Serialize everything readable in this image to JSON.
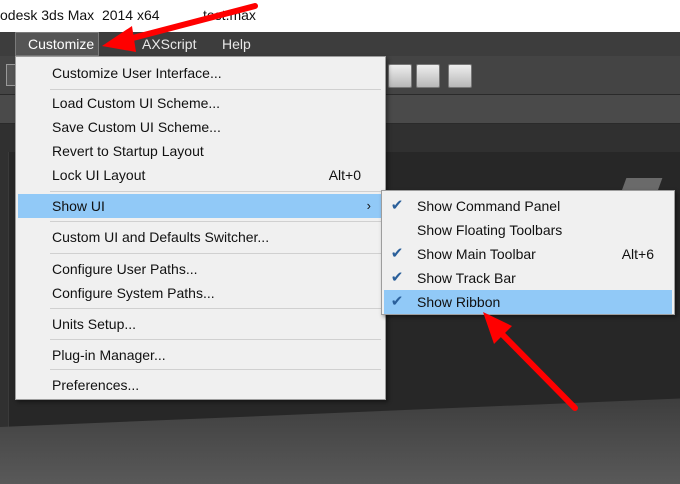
{
  "titlebar": {
    "app_title": "odesk 3ds Max  2014 x64",
    "file_name": "test.max"
  },
  "menubar": {
    "customize": "Customize",
    "maxscript": "AXScript",
    "help": "Help"
  },
  "customize_menu": {
    "items": [
      {
        "label": "Customize User Interface..."
      },
      {
        "label": "Load Custom UI Scheme..."
      },
      {
        "label": "Save Custom UI Scheme..."
      },
      {
        "label": "Revert to Startup Layout"
      },
      {
        "label": "Lock UI Layout",
        "shortcut": "Alt+0"
      },
      {
        "label": "Show UI",
        "submenu_arrow": "›"
      },
      {
        "label": "Custom UI and Defaults Switcher..."
      },
      {
        "label": "Configure User Paths..."
      },
      {
        "label": "Configure System Paths..."
      },
      {
        "label": "Units Setup..."
      },
      {
        "label": "Plug-in Manager..."
      },
      {
        "label": "Preferences..."
      }
    ]
  },
  "show_ui_submenu": {
    "check_glyph": "✔",
    "items": [
      {
        "label": "Show Command Panel",
        "checked": true
      },
      {
        "label": "Show Floating Toolbars",
        "checked": false
      },
      {
        "label": "Show Main Toolbar",
        "checked": true,
        "shortcut": "Alt+6"
      },
      {
        "label": "Show Track Bar",
        "checked": true
      },
      {
        "label": "Show Ribbon",
        "checked": true
      }
    ]
  },
  "colors": {
    "menu_highlight": "#91c9f7",
    "annotation_arrow": "#ff0000",
    "menubar_bg": "#3d3d3d",
    "viewport_bg": "#272727"
  }
}
